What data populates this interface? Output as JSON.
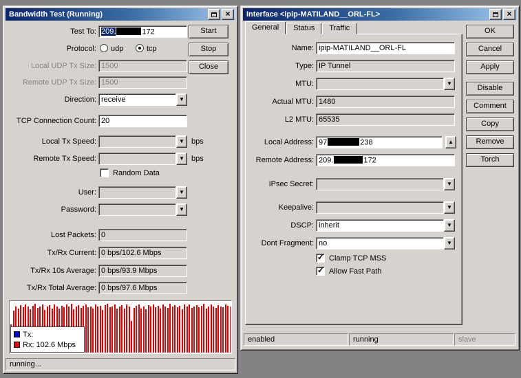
{
  "bw": {
    "title": "Bandwidth Test (Running)",
    "rows": {
      "test_to": {
        "label": "Test To:",
        "prefix": "209.",
        "suffix": "172"
      },
      "protocol": {
        "label": "Protocol:",
        "udp": "udp",
        "tcp": "tcp",
        "selected": "tcp"
      },
      "local_udp": {
        "label": "Local UDP Tx Size:",
        "value": "1500"
      },
      "remote_udp": {
        "label": "Remote UDP Tx Size:",
        "value": "1500"
      },
      "direction": {
        "label": "Direction:",
        "value": "receive"
      },
      "tcp_count": {
        "label": "TCP Connection Count:",
        "value": "20"
      },
      "local_speed": {
        "label": "Local Tx Speed:",
        "value": "",
        "unit": "bps"
      },
      "remote_speed": {
        "label": "Remote Tx Speed:",
        "value": "",
        "unit": "bps"
      },
      "random_data": {
        "label": "Random Data",
        "checked": false
      },
      "user": {
        "label": "User:",
        "value": ""
      },
      "password": {
        "label": "Password:",
        "value": ""
      },
      "lost": {
        "label": "Lost Packets:",
        "value": "0"
      },
      "current": {
        "label": "Tx/Rx Current:",
        "value": "0 bps/102.6 Mbps"
      },
      "avg10": {
        "label": "Tx/Rx 10s Average:",
        "value": "0 bps/93.9 Mbps"
      },
      "avg_total": {
        "label": "Tx/Rx Total Average:",
        "value": "0 bps/97.6 Mbps"
      }
    },
    "buttons": {
      "start": "Start",
      "stop": "Stop",
      "close": "Close"
    },
    "legend": {
      "tx_label": "Tx:",
      "rx_label": "Rx:  102.6 Mbps"
    },
    "status": "running...",
    "chart": {
      "type": "bar",
      "series": "Rx bandwidth",
      "unit": "percent of chart height",
      "colors": {
        "rx": "#e60000",
        "tx": "#0000f0"
      },
      "values": [
        55,
        82,
        90,
        86,
        93,
        89,
        95,
        91,
        85,
        92,
        96,
        88,
        90,
        94,
        84,
        91,
        93,
        87,
        95,
        90,
        86,
        92,
        89,
        94,
        91,
        96,
        85,
        90,
        93,
        88,
        92,
        95,
        89,
        91,
        86,
        94,
        90,
        92,
        84,
        93,
        96,
        89,
        91,
        94,
        87,
        90,
        93,
        86,
        95,
        91,
        62,
        88,
        92,
        94,
        87,
        91,
        85,
        93,
        90,
        95,
        89,
        92,
        86,
        94,
        91,
        88,
        96,
        90,
        93,
        89,
        92,
        85,
        94,
        91,
        95,
        88,
        90,
        93,
        89,
        92,
        96,
        86,
        91,
        94,
        90,
        88,
        93,
        91,
        89,
        95,
        92,
        90
      ]
    }
  },
  "iface": {
    "title": "Interface <ipip-MATILAND__ORL-FL>",
    "tabs": {
      "general": "General",
      "status": "Status",
      "traffic": "Traffic"
    },
    "rows": {
      "name": {
        "label": "Name:",
        "value": "ipip-MATILAND__ORL-FL"
      },
      "type": {
        "label": "Type:",
        "value": "IP Tunnel"
      },
      "mtu": {
        "label": "MTU:",
        "value": ""
      },
      "actual_mtu": {
        "label": "Actual MTU:",
        "value": "1480"
      },
      "l2_mtu": {
        "label": "L2 MTU:",
        "value": "65535"
      },
      "local_address": {
        "label": "Local Address:",
        "prefix": "97",
        "suffix": "238"
      },
      "remote_address": {
        "label": "Remote Address:",
        "prefix": "209.",
        "suffix": "172"
      },
      "ipsec": {
        "label": "IPsec Secret:",
        "value": ""
      },
      "keepalive": {
        "label": "Keepalive:",
        "value": ""
      },
      "dscp": {
        "label": "DSCP:",
        "value": "inherit"
      },
      "dont_fragment": {
        "label": "Dont Fragment:",
        "value": "no"
      },
      "clamp": {
        "label": "Clamp TCP MSS",
        "checked": true
      },
      "fast_path": {
        "label": "Allow Fast Path",
        "checked": true
      }
    },
    "buttons": {
      "ok": "OK",
      "cancel": "Cancel",
      "apply": "Apply",
      "disable": "Disable",
      "comment": "Comment",
      "copy": "Copy",
      "remove": "Remove",
      "torch": "Torch"
    },
    "status": {
      "enabled": "enabled",
      "running": "running",
      "slave": "slave"
    }
  }
}
